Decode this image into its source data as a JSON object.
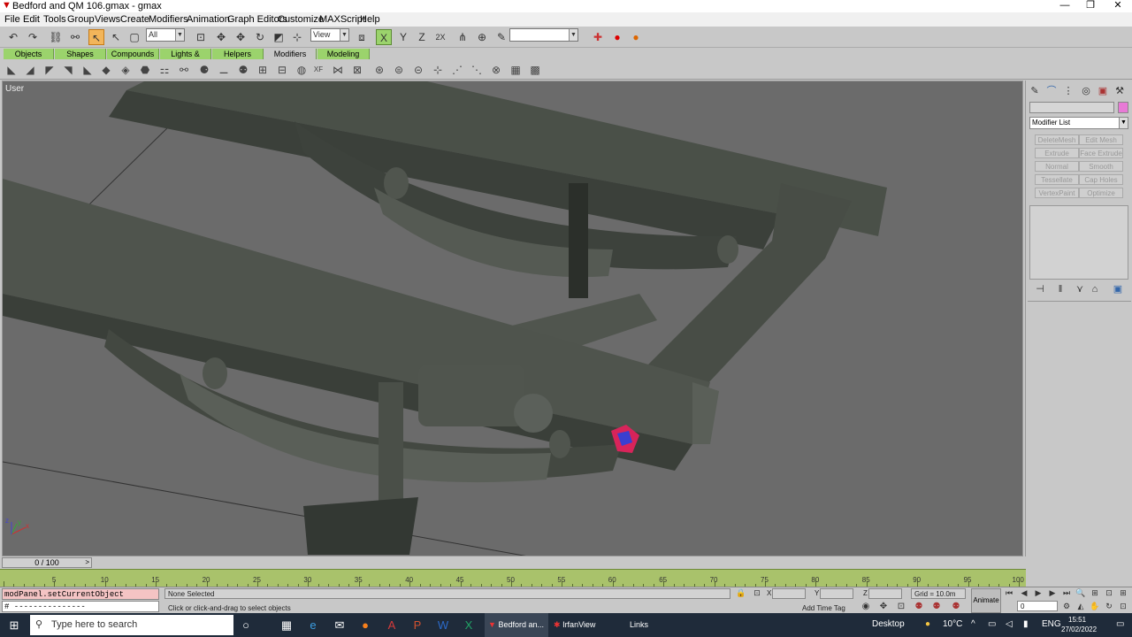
{
  "window": {
    "title": "Bedford and QM 106.gmax - gmax",
    "minimize": "—",
    "maximize": "❐",
    "close": "✕"
  },
  "menu": [
    "File",
    "Edit",
    "Tools",
    "Group",
    "Views",
    "Create",
    "Modifiers",
    "Animation",
    "Graph Editors",
    "Customize",
    "MAXScript",
    "Help"
  ],
  "toolbar": {
    "selection_filter": "All",
    "reference_coord": "View",
    "named_selection": ""
  },
  "tabs": [
    "Objects",
    "Shapes",
    "Compounds",
    "Lights & Cameras",
    "Helpers",
    "Modifiers",
    "Modeling"
  ],
  "tabs_selected": "Modifiers",
  "viewport": {
    "label": "User",
    "axis_x": "x",
    "axis_y": "y",
    "axis_z": "z"
  },
  "command_panel": {
    "object_name": "",
    "modifier_list": "Modifier List",
    "buttons": [
      "DeleteMesh",
      "Edit Mesh",
      "Extrude",
      "Face Extrude",
      "Normal",
      "Smooth",
      "Tessellate",
      "Cap Holes",
      "VertexPaint",
      "Optimize"
    ]
  },
  "timeline": {
    "slider": "0 / 100",
    "ticks": [
      "0",
      "5",
      "10",
      "15",
      "20",
      "25",
      "30",
      "35",
      "40",
      "45",
      "50",
      "55",
      "60",
      "65",
      "70",
      "75",
      "80",
      "85",
      "90",
      "95",
      "100"
    ]
  },
  "status": {
    "listener_input": "modPanel.setCurrentObject $FrontSpring",
    "listener_output": "# ---------------",
    "selection": "None Selected",
    "prompt": "Click or click-and-drag to select objects",
    "x_label": "X",
    "y_label": "Y",
    "z_label": "Z",
    "grid": "Grid = 10.0m",
    "add_time_tag": "Add Time Tag",
    "animate": "Animate",
    "frame": "0"
  },
  "taskbar": {
    "search_placeholder": "Type here to search",
    "tasks": [
      "Bedford an...",
      "IrfanView",
      "Links"
    ],
    "desktop": "Desktop",
    "weather": "10°C",
    "lang": "ENG",
    "time": "15:51",
    "date": "27/02/2022"
  },
  "colors": {
    "viewport_bg": "#6b6b6b",
    "tab_green": "#9bd36c",
    "ruler_green": "#a9c26b",
    "active_tool": "#f2b55a",
    "taskbar": "#1f2b3a"
  }
}
